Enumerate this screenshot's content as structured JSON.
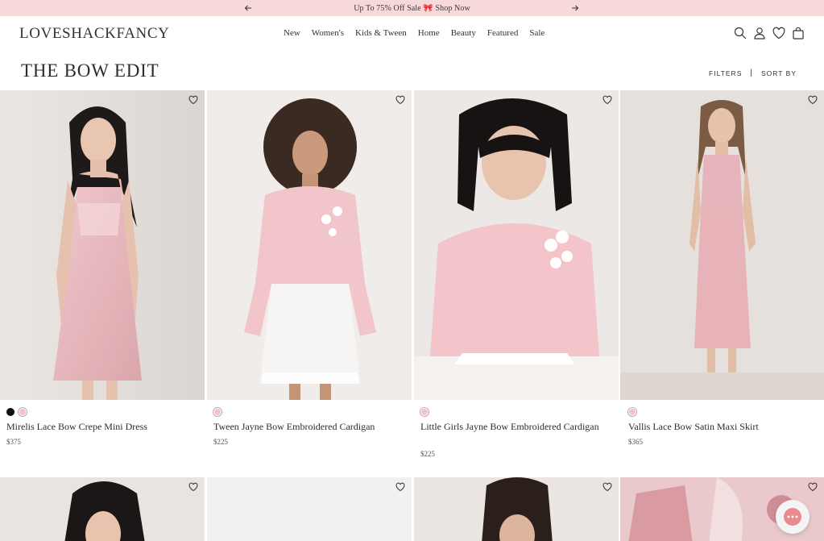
{
  "announcement": {
    "text": "Up To 75% Off Sale 🎀 Shop Now",
    "prev_icon": "arrow-left-icon",
    "next_icon": "arrow-right-icon"
  },
  "header": {
    "logo": "LOVESHACKFANCY",
    "nav": [
      "New",
      "Women's",
      "Kids & Tween",
      "Home",
      "Beauty",
      "Featured",
      "Sale"
    ],
    "icons": [
      "search-icon",
      "account-icon",
      "wishlist-icon",
      "bag-icon"
    ]
  },
  "page": {
    "title": "THE BOW EDIT",
    "filters_label": "FILTERS",
    "separator": "|",
    "sort_label": "SORT BY"
  },
  "products": [
    {
      "name": "Mirelis Lace Bow Crepe Mini Dress",
      "price": "$375",
      "swatches": [
        "black",
        "pink"
      ]
    },
    {
      "name": "Tween Jayne Bow Embroidered Cardigan",
      "price": "$225",
      "swatches": [
        "pink"
      ]
    },
    {
      "name": "Little Girls Jayne Bow Embroidered Cardigan",
      "price": "$225",
      "swatches": [
        "pink"
      ]
    },
    {
      "name": "Vallis Lace Bow Satin Maxi Skirt",
      "price": "$365",
      "swatches": [
        "pink"
      ]
    }
  ],
  "colors": {
    "announce_bg": "#f7d9da",
    "accent_pink": "#f2c4c8",
    "chat_accent": "#e98a8f"
  },
  "chat": {
    "icon": "chat-icon"
  }
}
